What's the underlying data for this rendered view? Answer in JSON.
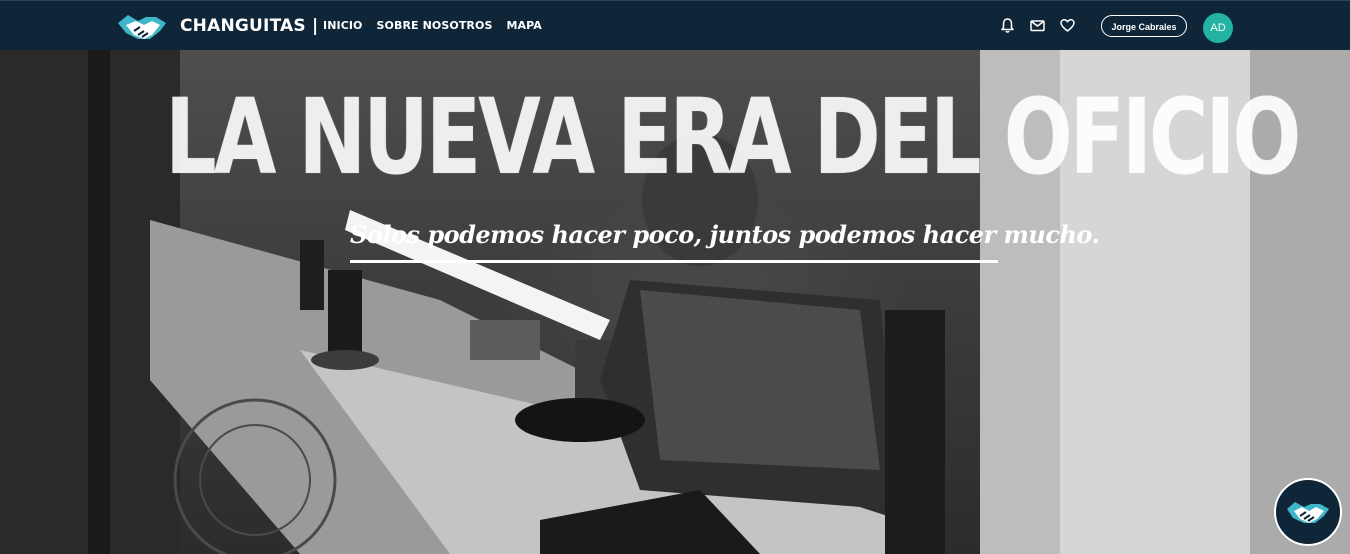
{
  "navbar": {
    "brand_name": "CHANGUITAS |",
    "links": [
      {
        "label": "INICIO"
      },
      {
        "label": "SOBRE NOSOTROS"
      },
      {
        "label": "MAPA"
      }
    ],
    "icons": [
      "bell-icon",
      "mail-icon",
      "heart-icon"
    ],
    "user_name": "Jorge Cabrales",
    "avatar_initials": "AD",
    "avatar_color": "#23b3a3",
    "background_color": "#0e2638"
  },
  "hero": {
    "title": "LA NUEVA ERA DEL OFICIO",
    "subtitle": "Solos podemos hacer poco, juntos podemos hacer mucho."
  },
  "floating_button": {
    "icon": "handshake-icon"
  }
}
